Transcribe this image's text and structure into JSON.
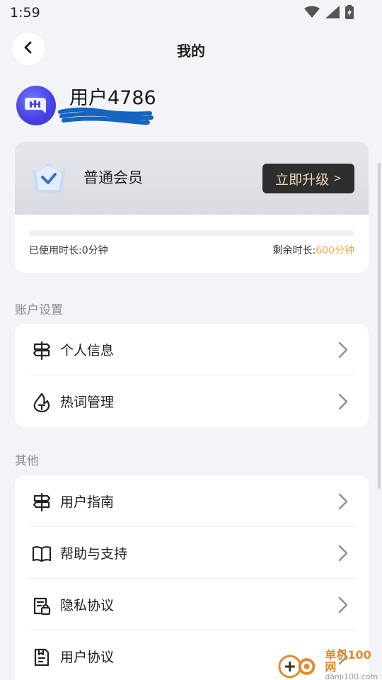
{
  "status_bar": {
    "time": "1:59",
    "icons": [
      "wifi-icon",
      "signal-icon",
      "battery-icon"
    ]
  },
  "header": {
    "title": "我的",
    "back_icon": "chevron-left-icon"
  },
  "profile": {
    "username": "用户4786"
  },
  "membership": {
    "level": "普通会员",
    "upgrade_label": "立即升级",
    "upgrade_arrow": ">",
    "used_label": "已使用时长:",
    "used_value": "0分钟",
    "remain_label": "剩余时长:",
    "remain_value": "600分钟",
    "progress": 0
  },
  "sections": {
    "account": {
      "label": "账户设置",
      "items": [
        {
          "label": "个人信息",
          "icon": "signpost-icon"
        },
        {
          "label": "热词管理",
          "icon": "fire-icon"
        }
      ]
    },
    "other": {
      "label": "其他",
      "items": [
        {
          "label": "用户指南",
          "icon": "signpost-icon"
        },
        {
          "label": "帮助与支持",
          "icon": "book-icon"
        },
        {
          "label": "隐私协议",
          "icon": "lock-document-icon"
        },
        {
          "label": "用户协议",
          "icon": "document-icon"
        }
      ]
    }
  },
  "watermark": {
    "main": "单机100网",
    "sub": "danji100.com"
  },
  "colors": {
    "accent": "#f0a545",
    "upgrade_bg": "#2e2e2e",
    "upgrade_text": "#f0d9b5",
    "avatar": "#4a42e6"
  }
}
